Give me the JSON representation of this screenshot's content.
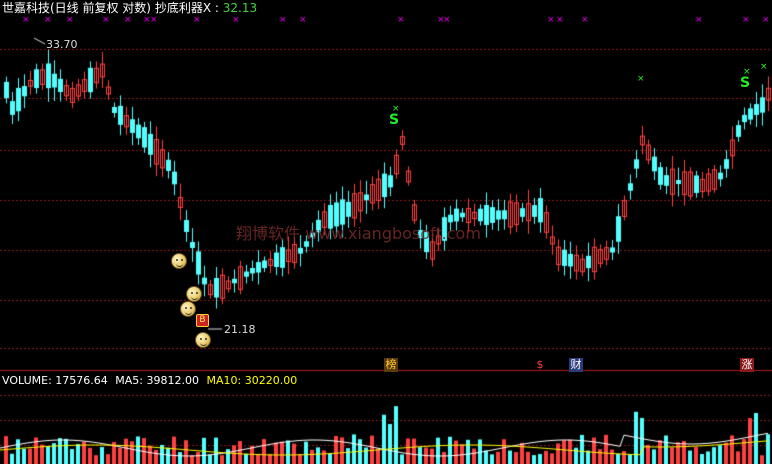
{
  "header": {
    "title": "世嘉科技(日线 前复权 对数)",
    "indicator_label": "抄底利器X :",
    "indicator_value": "32.13"
  },
  "price_annotations": {
    "high": "33.70",
    "low": "21.18"
  },
  "watermark": "翔博软件 www.xiangbosoft.com",
  "event_tags": {
    "bang": "榜",
    "dollar": "$",
    "cai": "财",
    "zhang": "涨"
  },
  "signals": {
    "s_label": "S",
    "x_label": "×",
    "coin_label": "B"
  },
  "volume_header": {
    "volume_label": "VOLUME:",
    "volume_value": "17576.64",
    "ma5_label": "MA5:",
    "ma5_value": "39812.00",
    "ma10_label": "MA10:",
    "ma10_value": "30220.00"
  },
  "colors": {
    "up": "#ff4040",
    "down": "#54ffff",
    "grid": "#8c1a1a",
    "magenta": "#ff00ff",
    "ma5": "#ffffff",
    "ma10": "#ffff00"
  }
}
